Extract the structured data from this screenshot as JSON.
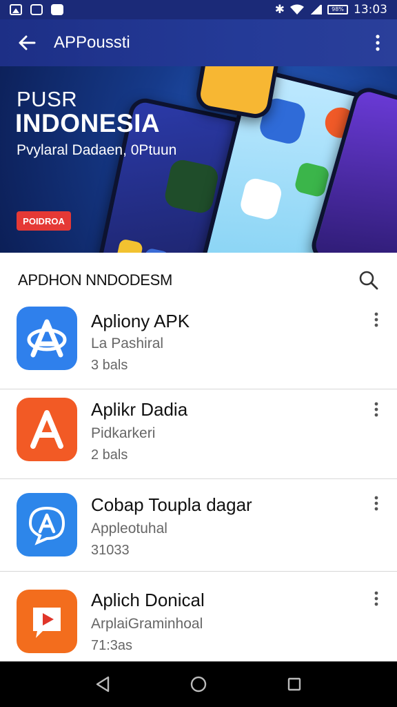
{
  "status_bar": {
    "time": "13:03",
    "battery": "98%",
    "left_icons": [
      "image-icon",
      "message-icon",
      "youtube-icon"
    ],
    "right_icons": [
      "bluetooth-icon",
      "wifi-icon",
      "signal-icon",
      "battery-icon"
    ]
  },
  "app_bar": {
    "title": "APPoussti",
    "back_icon": "arrow-left-icon",
    "menu_icon": "more-vertical-icon"
  },
  "banner": {
    "subtitle": "PUSR",
    "title": "INDONESIA",
    "tagline": "Pvylaral Dadaen, 0Ptuun",
    "button_label": "POIDROA"
  },
  "section": {
    "title": "APDHON NNDODESM",
    "search_icon": "search-icon"
  },
  "apps": [
    {
      "name": "Apliony APK",
      "subtitle": "La Pashiral",
      "size": "3 bals",
      "icon": "app-a-icon",
      "color": "#2f80ec"
    },
    {
      "name": "Aplikr Dadia",
      "subtitle": "Pidkarkeri",
      "size": "2 bals",
      "icon": "app-letter-a-icon",
      "color": "#f25a25"
    },
    {
      "name": "Cobap Toupla dagar",
      "subtitle": "Appleotuhal",
      "size": "31033",
      "icon": "app-chat-a-icon",
      "color": "#2d86ea"
    },
    {
      "name": "Aplich Donical",
      "subtitle": "ArplaiGraminhoal",
      "size": "71:3as",
      "icon": "app-play-icon",
      "color": "#f36d1d"
    }
  ],
  "nav_bar": {
    "buttons": [
      "back-triangle-icon",
      "home-circle-icon",
      "recents-square-icon"
    ]
  }
}
